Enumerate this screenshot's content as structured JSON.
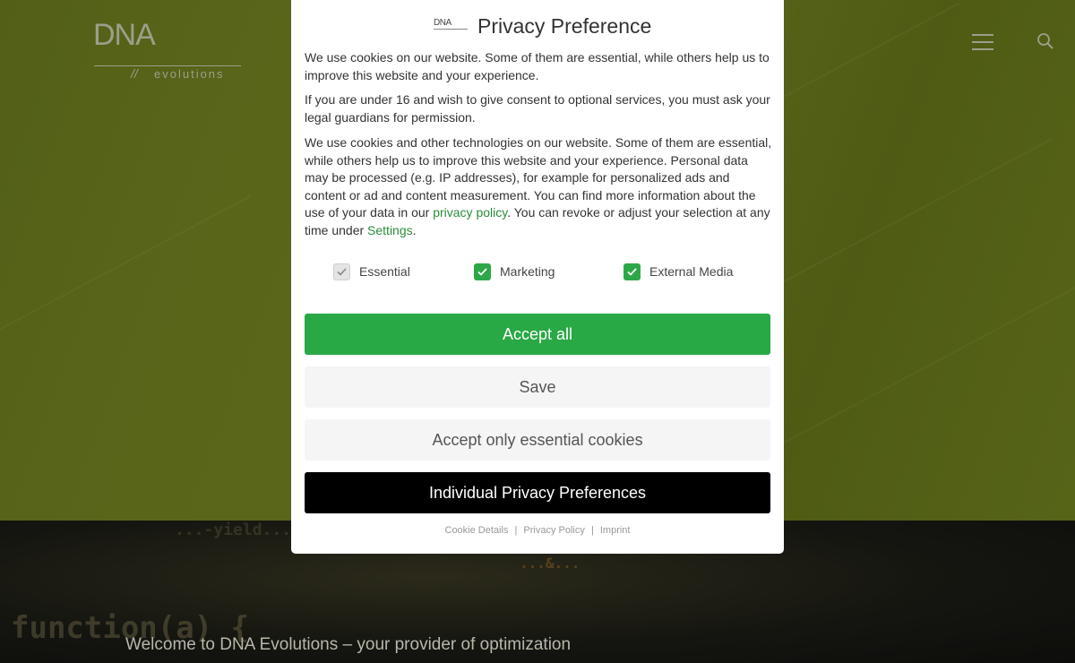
{
  "site": {
    "logo_main": "DNA",
    "logo_sub": "evolutions",
    "logo_slashes": "//",
    "menu_icon": "hamburger-menu-icon",
    "search_icon": "search-icon",
    "welcome_text": "Welcome to DNA Evolutions – your provider of optimization",
    "background_code": [
      "...-yield...",
      "...&...",
      "function(a) {"
    ]
  },
  "dialog": {
    "logo_text": "DNA",
    "title": "Privacy Preference",
    "paragraph1": "We use cookies on our website. Some of them are essential, while others help us to improve this website and your experience.",
    "paragraph2": "If you are under 16 and wish to give consent to optional services, you must ask your legal guardians for permission.",
    "paragraph3_part1": "We use cookies and other technologies on our website. Some of them are essential, while others help us to improve this website and your experience. Personal data may be processed (e.g. IP addresses), for example for personalized ads and content or ad and content measurement. You can find more information about the use of your data in our ",
    "paragraph3_link1": "privacy policy",
    "paragraph3_part2": ". You can revoke or adjust your selection at any time under ",
    "paragraph3_link2": "Settings",
    "paragraph3_part3": ".",
    "consents": [
      {
        "label": "Essential",
        "checked": true,
        "disabled": true
      },
      {
        "label": "Marketing",
        "checked": true,
        "disabled": false
      },
      {
        "label": "External Media",
        "checked": true,
        "disabled": false
      }
    ],
    "buttons": {
      "accept_all": "Accept all",
      "save": "Save",
      "accept_essential": "Accept only essential cookies",
      "individual": "Individual Privacy Preferences"
    },
    "footer_links": [
      "Cookie Details",
      "Privacy Policy",
      "Imprint"
    ],
    "footer_separator": "|"
  },
  "colors": {
    "accent_green": "#29a846",
    "link_green": "#2a8c3a",
    "hero_olive": "#59661a"
  }
}
